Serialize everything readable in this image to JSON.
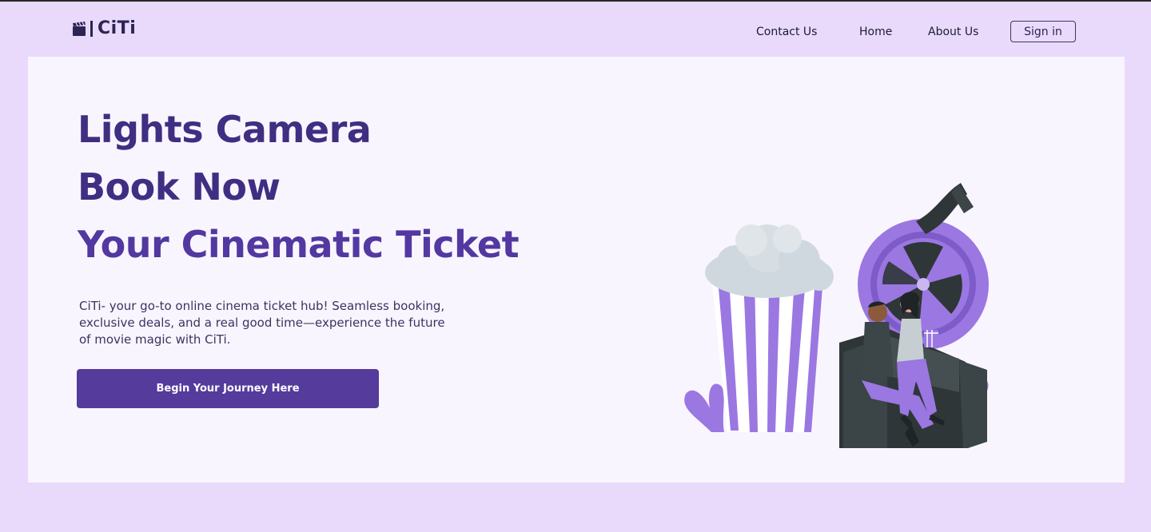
{
  "brand": {
    "logo_text": "CiTi"
  },
  "nav": {
    "links": [
      "Contact Us",
      "Home",
      "About Us"
    ],
    "signin_label": "Sign in"
  },
  "hero": {
    "headline_lines": [
      "Lights Camera",
      "Book Now",
      "Your Cinematic Ticket"
    ],
    "description": "CiTi- your go-to online cinema ticket hub! Seamless booking, exclusive deals, and a real good time—experience the future of movie magic with CiTi.",
    "cta_label": "Begin Your Journey Here"
  },
  "colors": {
    "page_bg": "#e9dafc",
    "hero_bg": "#f9f5fe",
    "headline": "#3f2e82",
    "accent": "#543b9c",
    "illustration_purple": "#9b77e2"
  },
  "icons": {
    "logo": "clapperboard-icon",
    "illustration": "cinema-couple-popcorn-film-reel-illustration"
  }
}
